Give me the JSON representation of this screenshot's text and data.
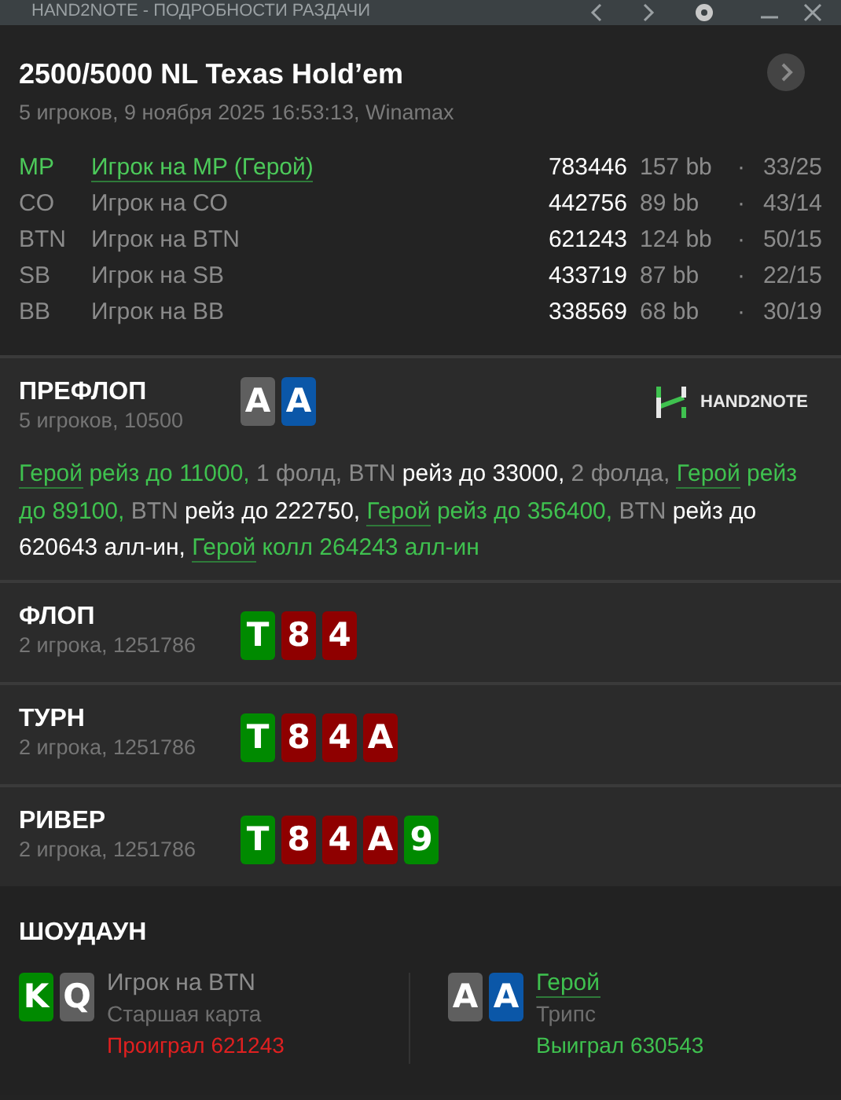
{
  "window": {
    "title": "HAND2NOTE - ПОДРОБНОСТИ РАЗДАЧИ"
  },
  "hand": {
    "title": "2500/5000 NL Texas Hold’em",
    "subtitle": "5 игроков, 9 ноября 2025 16:53:13, Winamax"
  },
  "players": [
    {
      "position": "MP",
      "name": "Игрок на MP (Герой)",
      "stack": "783446",
      "bb": "157 bb",
      "sep": "·",
      "stats": "33/25",
      "selected": true
    },
    {
      "position": "CO",
      "name": "Игрок на CO",
      "stack": "442756",
      "bb": "89 bb",
      "sep": "·",
      "stats": "43/14",
      "selected": false
    },
    {
      "position": "BTN",
      "name": "Игрок на BTN",
      "stack": "621243",
      "bb": "124 bb",
      "sep": "·",
      "stats": "50/15",
      "selected": false
    },
    {
      "position": "SB",
      "name": "Игрок на SB",
      "stack": "433719",
      "bb": "87 bb",
      "sep": "·",
      "stats": "22/15",
      "selected": false
    },
    {
      "position": "BB",
      "name": "Игрок на BB",
      "stack": "338569",
      "bb": "68 bb",
      "sep": "·",
      "stats": "30/19",
      "selected": false
    }
  ],
  "logo": "HAND2NOTE",
  "streets": [
    {
      "name": "ПРЕФЛОП",
      "info": "5 игроков, 10500",
      "cards": [
        {
          "rank": "A",
          "color": "#5f5f5f"
        },
        {
          "rank": "A",
          "color": "#0b57a8"
        }
      ],
      "actions": [
        {
          "kind": "hero-link",
          "text": "Герой"
        },
        {
          "kind": "hero",
          "text": " рейз до 11000,"
        },
        {
          "kind": "muted",
          "text": " 1 фолд, BTN"
        },
        {
          "kind": "plain",
          "text": " рейз до 33000,"
        },
        {
          "kind": "muted",
          "text": " 2 фолда, "
        },
        {
          "kind": "hero-link",
          "text": "Герой"
        },
        {
          "kind": "hero",
          "text": " рейз до 89100,"
        },
        {
          "kind": "muted",
          "text": " BTN"
        },
        {
          "kind": "plain",
          "text": " рейз до 222750, "
        },
        {
          "kind": "hero-link",
          "text": "Герой"
        },
        {
          "kind": "hero",
          "text": " рейз до 356400,"
        },
        {
          "kind": "muted",
          "text": " BTN"
        },
        {
          "kind": "plain",
          "text": " рейз до 620643 алл-ин, "
        },
        {
          "kind": "hero-link",
          "text": "Герой"
        },
        {
          "kind": "hero",
          "text": " колл 264243 алл-ин"
        }
      ]
    },
    {
      "name": "ФЛОП",
      "info": "2 игрока, 1251786",
      "cards": [
        {
          "rank": "T",
          "color": "#008a00"
        },
        {
          "rank": "8",
          "color": "#8f0000"
        },
        {
          "rank": "4",
          "color": "#8f0000"
        }
      ]
    },
    {
      "name": "ТУРН",
      "info": "2 игрока, 1251786",
      "cards": [
        {
          "rank": "T",
          "color": "#008a00"
        },
        {
          "rank": "8",
          "color": "#8f0000"
        },
        {
          "rank": "4",
          "color": "#8f0000"
        },
        {
          "rank": "A",
          "color": "#8f0000"
        }
      ]
    },
    {
      "name": "РИВЕР",
      "info": "2 игрока, 1251786",
      "cards": [
        {
          "rank": "T",
          "color": "#008a00"
        },
        {
          "rank": "8",
          "color": "#8f0000"
        },
        {
          "rank": "4",
          "color": "#8f0000"
        },
        {
          "rank": "A",
          "color": "#8f0000"
        },
        {
          "rank": "9",
          "color": "#008a00"
        }
      ]
    }
  ],
  "showdown": {
    "title": "ШОУДАУН",
    "hands": [
      {
        "cards": [
          {
            "rank": "K",
            "color": "#008a00"
          },
          {
            "rank": "Q",
            "color": "#5f5f5f"
          }
        ],
        "player": "Игрок на BTN",
        "hero": false,
        "combo": "Старшая карта",
        "result": "Проиграл 621243",
        "won": false
      },
      {
        "cards": [
          {
            "rank": "A",
            "color": "#5f5f5f"
          },
          {
            "rank": "A",
            "color": "#0b57a8"
          }
        ],
        "player": "Герой",
        "hero": true,
        "combo": "Трипс",
        "result": "Выиграл 630543",
        "won": true
      }
    ]
  }
}
